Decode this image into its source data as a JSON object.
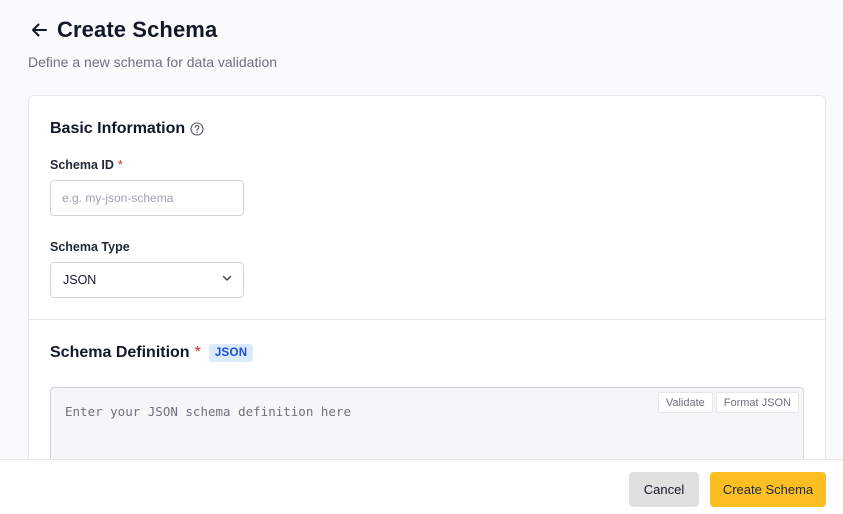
{
  "header": {
    "back_icon": "arrow-left-icon",
    "title": "Create Schema",
    "subtitle": "Define a new schema for data validation"
  },
  "basic_info": {
    "title": "Basic Information",
    "help_icon": "question-circle-icon",
    "schema_id": {
      "label": "Schema ID",
      "required_mark": "*",
      "value": "",
      "placeholder": "e.g. my-json-schema"
    },
    "schema_type": {
      "label": "Schema Type",
      "selected": "JSON",
      "icon": "chevron-down-icon"
    }
  },
  "definition": {
    "title": "Schema Definition",
    "required_mark": "*",
    "badge": "JSON",
    "placeholder": "Enter your JSON schema definition here",
    "validate_label": "Validate",
    "format_label": "Format JSON"
  },
  "footer": {
    "cancel_label": "Cancel",
    "create_label": "Create Schema"
  },
  "colors": {
    "accent": "#fbbf24",
    "required": "#dc2626",
    "badge_bg": "#dbeafe",
    "badge_text": "#1d4ed8"
  }
}
